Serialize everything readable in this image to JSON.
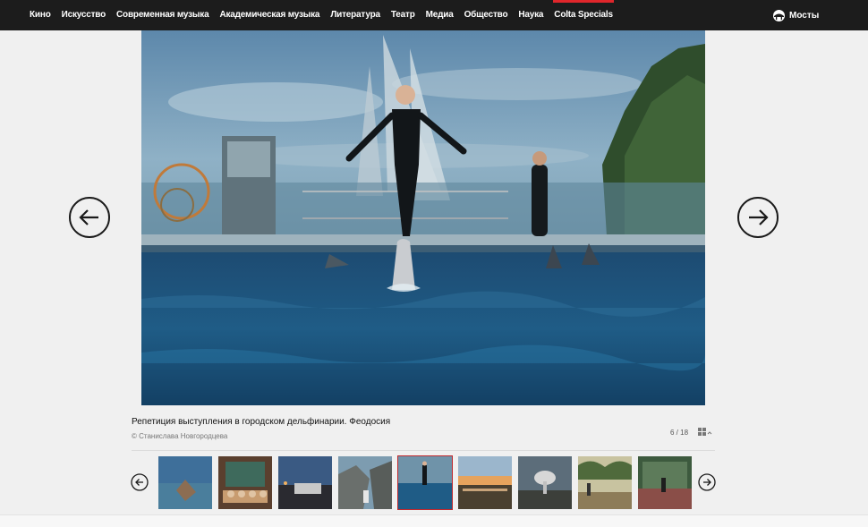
{
  "nav": {
    "items": [
      {
        "label": "Кино"
      },
      {
        "label": "Искусство"
      },
      {
        "label": "Современная музыка"
      },
      {
        "label": "Академическая музыка"
      },
      {
        "label": "Литература"
      },
      {
        "label": "Театр"
      },
      {
        "label": "Медиа"
      },
      {
        "label": "Общество"
      },
      {
        "label": "Наука"
      },
      {
        "label": "Colta Specials",
        "active": true
      }
    ],
    "mosty_label": "Мосты"
  },
  "gallery": {
    "caption": "Репетиция выступления в городском дельфинарии. Феодосия",
    "credit": "© Станислава Новгородцева",
    "counter": "6 / 18",
    "current": 6,
    "total": 18,
    "icons": {
      "prev": "arrow-left-circle-icon",
      "next": "arrow-right-circle-icon",
      "grid": "grid-icon",
      "brand": "mosty-logo-icon"
    }
  },
  "colors": {
    "nav_bg": "#1c1c1c",
    "active_accent": "#e0262b",
    "page_bg": "#f0f0f0"
  }
}
